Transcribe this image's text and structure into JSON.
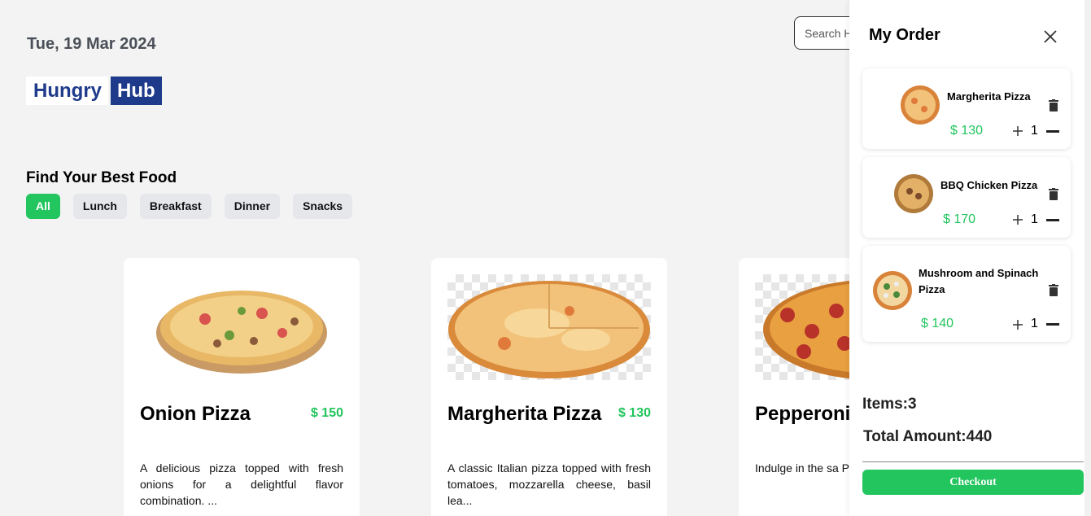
{
  "header": {
    "date": "Tue, 19 Mar 2024",
    "logo_part1": "Hungry",
    "logo_part2": "Hub",
    "search_placeholder": "Search H"
  },
  "filters": {
    "title": "Find Your Best Food",
    "categories": [
      "All",
      "Lunch",
      "Breakfast",
      "Dinner",
      "Snacks"
    ],
    "active": "All"
  },
  "menu": [
    {
      "name": "Onion Pizza",
      "price": "150",
      "currency": "$",
      "description": "A delicious pizza topped with fresh onions for a delightful flavor combination. ..."
    },
    {
      "name": "Margherita Pizza",
      "price": "130",
      "currency": "$",
      "description": "A classic Italian pizza topped with fresh tomatoes, mozzarella cheese, basil lea..."
    },
    {
      "name": "Pepperoni",
      "price": "",
      "currency": "",
      "description": "Indulge in the sa Pepperoni Pizza, spi..."
    }
  ],
  "order": {
    "title": "My Order",
    "items": [
      {
        "name": "Margherita Pizza",
        "currency": "$",
        "price": "130",
        "qty": "1"
      },
      {
        "name": "BBQ Chicken Pizza",
        "currency": "$",
        "price": "170",
        "qty": "1"
      },
      {
        "name": "Mushroom and Spinach Pizza",
        "currency": "$",
        "price": "140",
        "qty": "1"
      }
    ],
    "items_label": "Items:3",
    "total_label": "Total Amount:440",
    "checkout_label": "Checkout"
  },
  "colors": {
    "accent_green": "#22c55e",
    "brand_blue": "#1e3a8a"
  }
}
